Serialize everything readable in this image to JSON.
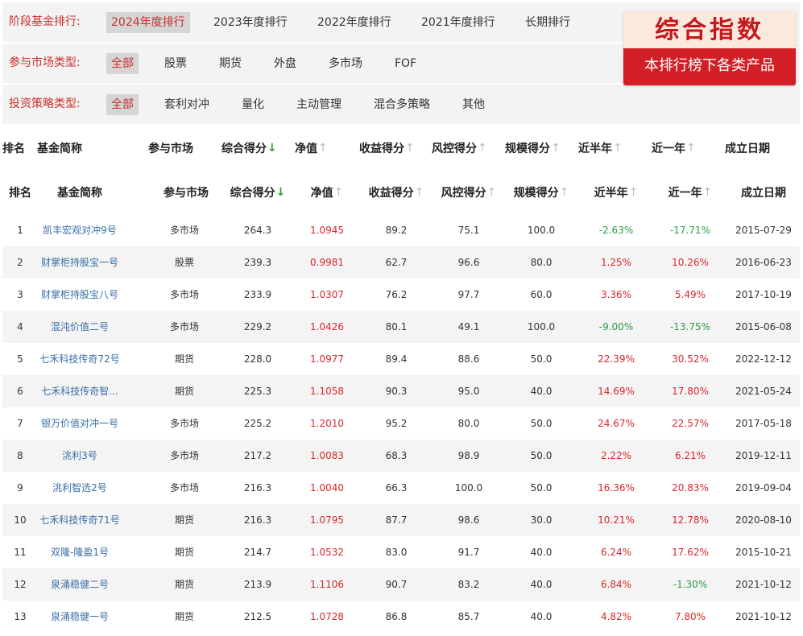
{
  "filters": {
    "stage": {
      "label": "阶段基金排行:",
      "options": [
        "2024年度排行",
        "2023年度排行",
        "2022年度排行",
        "2021年度排行",
        "长期排行"
      ],
      "active": "2024年度排行"
    },
    "market": {
      "label": "参与市场类型:",
      "options": [
        "全部",
        "股票",
        "期货",
        "外盘",
        "多市场",
        "FOF"
      ],
      "active": "全部"
    },
    "strategy": {
      "label": "投资策略类型:",
      "options": [
        "全部",
        "套利对冲",
        "量化",
        "主动管理",
        "混合多策略",
        "其他"
      ],
      "active": "全部"
    }
  },
  "badge": {
    "title": "综合指数",
    "subtitle": "本排行榜下各类产品"
  },
  "table": {
    "headers": {
      "rank": "排名",
      "name": "基金简称",
      "market": "参与市场",
      "score": "综合得分",
      "nav": "净值",
      "return_score": "收益得分",
      "risk_score": "风控得分",
      "scale_score": "规模得分",
      "half_year": "近半年",
      "one_year": "近一年",
      "inception": "成立日期"
    },
    "sort_icons": {
      "active": "down-arrow-icon",
      "inactive": "up-arrow-icon"
    },
    "rows": [
      {
        "rank": "1",
        "name": "凯丰宏观对冲9号",
        "market": "多市场",
        "score": "264.3",
        "nav": "1.0945",
        "return_score": "89.2",
        "risk_score": "75.1",
        "scale_score": "100.0",
        "half_year": "-2.63%",
        "one_year": "-17.71%",
        "inception": "2015-07-29"
      },
      {
        "rank": "2",
        "name": "财掌柜持股宝一号",
        "market": "股票",
        "score": "239.3",
        "nav": "0.9981",
        "return_score": "62.7",
        "risk_score": "96.6",
        "scale_score": "80.0",
        "half_year": "1.25%",
        "one_year": "10.26%",
        "inception": "2016-06-23"
      },
      {
        "rank": "3",
        "name": "财掌柜持股宝八号",
        "market": "多市场",
        "score": "233.9",
        "nav": "1.0307",
        "return_score": "76.2",
        "risk_score": "97.7",
        "scale_score": "60.0",
        "half_year": "3.36%",
        "one_year": "5.49%",
        "inception": "2017-10-19"
      },
      {
        "rank": "4",
        "name": "混沌价值二号",
        "market": "多市场",
        "score": "229.2",
        "nav": "1.0426",
        "return_score": "80.1",
        "risk_score": "49.1",
        "scale_score": "100.0",
        "half_year": "-9.00%",
        "one_year": "-13.75%",
        "inception": "2015-06-08"
      },
      {
        "rank": "5",
        "name": "七禾科技传奇72号",
        "market": "期货",
        "score": "228.0",
        "nav": "1.0977",
        "return_score": "89.4",
        "risk_score": "88.6",
        "scale_score": "50.0",
        "half_year": "22.39%",
        "one_year": "30.52%",
        "inception": "2022-12-12"
      },
      {
        "rank": "6",
        "name": "七禾科技传奇智...",
        "market": "期货",
        "score": "225.3",
        "nav": "1.1058",
        "return_score": "90.3",
        "risk_score": "95.0",
        "scale_score": "40.0",
        "half_year": "14.69%",
        "one_year": "17.80%",
        "inception": "2021-05-24"
      },
      {
        "rank": "7",
        "name": "银万价值对冲一号",
        "market": "多市场",
        "score": "225.2",
        "nav": "1.2010",
        "return_score": "95.2",
        "risk_score": "80.0",
        "scale_score": "50.0",
        "half_year": "24.67%",
        "one_year": "22.57%",
        "inception": "2017-05-18"
      },
      {
        "rank": "8",
        "name": "洮利3号",
        "market": "多市场",
        "score": "217.2",
        "nav": "1.0083",
        "return_score": "68.3",
        "risk_score": "98.9",
        "scale_score": "50.0",
        "half_year": "2.22%",
        "one_year": "6.21%",
        "inception": "2019-12-11"
      },
      {
        "rank": "9",
        "name": "洮利智选2号",
        "market": "多市场",
        "score": "216.3",
        "nav": "1.0040",
        "return_score": "66.3",
        "risk_score": "100.0",
        "scale_score": "50.0",
        "half_year": "16.36%",
        "one_year": "20.83%",
        "inception": "2019-09-04"
      },
      {
        "rank": "10",
        "name": "七禾科技传奇71号",
        "market": "期货",
        "score": "216.3",
        "nav": "1.0795",
        "return_score": "87.7",
        "risk_score": "98.6",
        "scale_score": "30.0",
        "half_year": "10.21%",
        "one_year": "12.78%",
        "inception": "2020-08-10"
      },
      {
        "rank": "11",
        "name": "双隆-隆盈1号",
        "market": "期货",
        "score": "214.7",
        "nav": "1.0532",
        "return_score": "83.0",
        "risk_score": "91.7",
        "scale_score": "40.0",
        "half_year": "6.24%",
        "one_year": "17.62%",
        "inception": "2015-10-21"
      },
      {
        "rank": "12",
        "name": "泉涌稳健二号",
        "market": "期货",
        "score": "213.9",
        "nav": "1.1106",
        "return_score": "90.7",
        "risk_score": "83.2",
        "scale_score": "40.0",
        "half_year": "6.84%",
        "one_year": "-1.30%",
        "inception": "2021-10-12"
      },
      {
        "rank": "13",
        "name": "泉涌稳健一号",
        "market": "期货",
        "score": "212.5",
        "nav": "1.0728",
        "return_score": "86.8",
        "risk_score": "85.7",
        "scale_score": "40.0",
        "half_year": "4.82%",
        "one_year": "7.80%",
        "inception": "2021-10-12"
      }
    ]
  },
  "colors": {
    "accent_red": "#c9302c",
    "positive": "#d9262c",
    "negative": "#2e9a45",
    "link": "#3a6ea5"
  }
}
